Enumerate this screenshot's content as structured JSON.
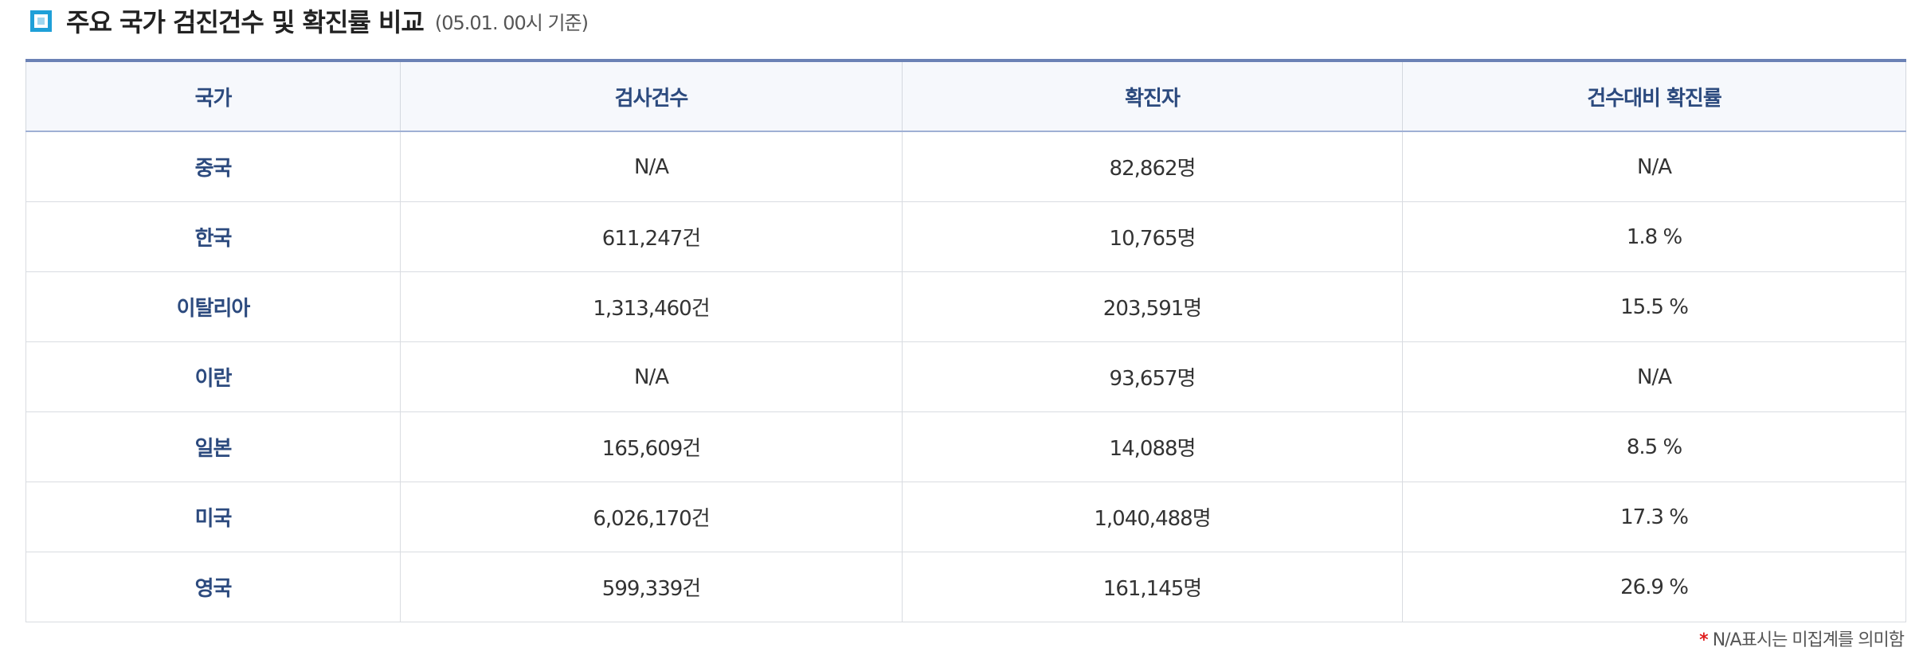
{
  "header": {
    "title": "주요 국가 검진건수 및 확진률 비교",
    "subtitle": "(05.01. 00시 기준)"
  },
  "table": {
    "columns": [
      "국가",
      "검사건수",
      "확진자",
      "건수대비 확진률"
    ],
    "rows": [
      [
        "중국",
        "N/A",
        "82,862명",
        "N/A"
      ],
      [
        "한국",
        "611,247건",
        "10,765명",
        "1.8 %"
      ],
      [
        "이탈리아",
        "1,313,460건",
        "203,591명",
        "15.5 %"
      ],
      [
        "이란",
        "N/A",
        "93,657명",
        "N/A"
      ],
      [
        "일본",
        "165,609건",
        "14,088명",
        "8.5 %"
      ],
      [
        "미국",
        "6,026,170건",
        "1,040,488명",
        "17.3 %"
      ],
      [
        "영국",
        "599,339건",
        "161,145명",
        "26.9 %"
      ]
    ]
  },
  "footnote": {
    "marker": "*",
    "text": "N/A표시는 미집계를 의미함"
  },
  "colors": {
    "accent_icon": "#1fa0d8",
    "header_text": "#2c4a7e",
    "header_border": "#6b82b5",
    "footnote_marker": "#e02020"
  }
}
